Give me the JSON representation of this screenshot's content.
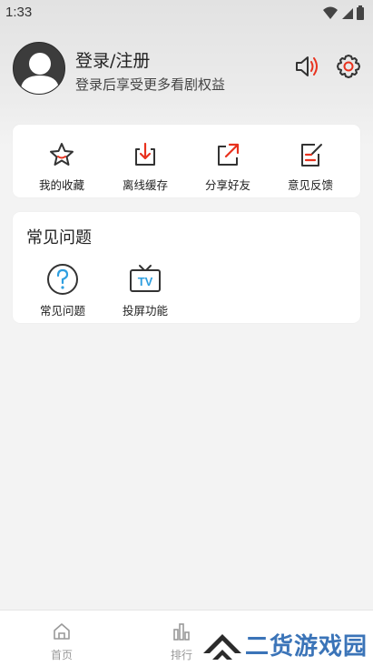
{
  "status_bar": {
    "time": "1:33"
  },
  "profile": {
    "title": "登录/注册",
    "subtitle": "登录后享受更多看剧权益",
    "icons": [
      "avatar-icon",
      "sound-icon",
      "settings-icon"
    ]
  },
  "actions": [
    {
      "label": "我的收藏",
      "icon": "star-icon"
    },
    {
      "label": "离线缓存",
      "icon": "download-icon"
    },
    {
      "label": "分享好友",
      "icon": "share-icon"
    },
    {
      "label": "意见反馈",
      "icon": "feedback-icon"
    }
  ],
  "faq": {
    "title": "常见问题",
    "items": [
      {
        "label": "常见问题",
        "icon": "question-icon"
      },
      {
        "label": "投屏功能",
        "icon": "tv-icon"
      }
    ]
  },
  "bottom_nav": [
    {
      "label": "首页",
      "icon": "home-icon"
    },
    {
      "label": "排行",
      "icon": "ranking-icon"
    }
  ],
  "watermark": {
    "text": "二货游戏园"
  },
  "colors": {
    "accent_red": "#e8321e",
    "watermark_blue": "#3b74b8",
    "icon_dark": "#333333"
  }
}
